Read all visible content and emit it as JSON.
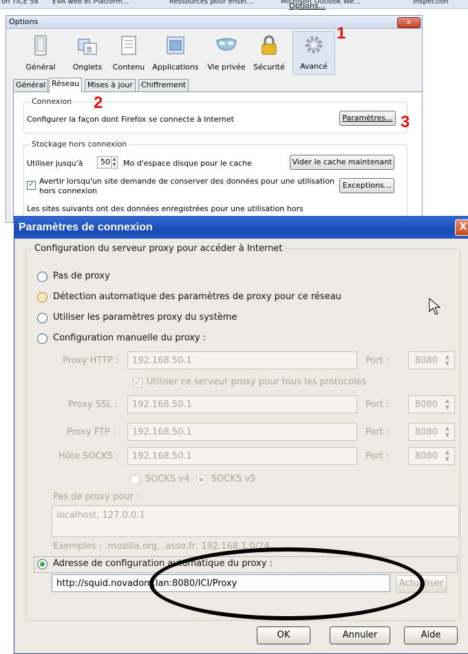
{
  "topbar": {
    "items": [
      "on TICE 58",
      "EVA web et Platform...",
      "Ressources pour ensei...",
      "Options...",
      "Microsoft Outlook We...",
      "Inspection"
    ]
  },
  "options_window": {
    "title": "Options",
    "close": "x",
    "panes": [
      {
        "label": "Général",
        "icon": "general-icon"
      },
      {
        "label": "Onglets",
        "icon": "tabs-icon"
      },
      {
        "label": "Contenu",
        "icon": "content-icon"
      },
      {
        "label": "Applications",
        "icon": "applications-icon"
      },
      {
        "label": "Vie privée",
        "icon": "privacy-mask-icon"
      },
      {
        "label": "Sécurité",
        "icon": "padlock-icon"
      },
      {
        "label": "Avancé",
        "icon": "gear-icon"
      }
    ],
    "tabs": [
      "Général",
      "Réseau",
      "Mises à jour",
      "Chiffrement"
    ],
    "connexion": {
      "label": "Connexion",
      "text": "Configurer la façon dont Firefox se connecte à Internet",
      "button": "Paramètres..."
    },
    "offline": {
      "label": "Stockage hors connexion",
      "use_up_to": "Utiliser jusqu'à",
      "cache_value": "50",
      "cache_unit": "Mo d'espace disque pour le cache",
      "clear_button": "Vider le cache maintenant",
      "warn_line1": "Avertir lorsqu'un site demande de conserver des données pour une utilisation",
      "warn_line2": "hors connexion",
      "exceptions_button": "Exceptions...",
      "sites_text": "Les sites suivants ont des données enregistrées pour une utilisation hors"
    },
    "markers": [
      "1",
      "2",
      "3"
    ]
  },
  "dialog": {
    "title": "Paramètres de connexion",
    "close": "X",
    "group_label": "Configuration du serveur proxy pour accéder à Internet",
    "options": {
      "no_proxy": "Pas de proxy",
      "auto_detect": "Détection automatique des paramètres de proxy pour ce réseau",
      "system": "Utiliser les paramètres proxy du système",
      "manual": "Configuration manuelle du proxy :"
    },
    "manual": {
      "http_label": "Proxy HTTP :",
      "http_value": "192.168.50.1",
      "http_port": "8080",
      "same_proxy": "Utiliser ce serveur proxy pour tous les protocoles",
      "ssl_label": "Proxy SSL :",
      "ssl_value": "192.168.50.1",
      "ssl_port": "8080",
      "ftp_label": "Proxy FTP :",
      "ftp_value": "192.168.50.1",
      "ftp_port": "8080",
      "socks_label": "Hôte SOCKS :",
      "socks_value": "192.168.50.1",
      "socks_port": "8080",
      "port_label": "Port :",
      "socks_v4": "SOCKS v4",
      "socks_v5": "SOCKS v5"
    },
    "no_proxy_for_label": "Pas de proxy pour :",
    "no_proxy_for_value": "localhost, 127.0.0.1",
    "examples": "Exemples : .mozilla.org, .asso.fr, 192.168.1.0/24",
    "auto_config_label": "Adresse de configuration automatique du proxy :",
    "auto_config_url": "http://squid.novadom.lan:8080/ICI/Proxy",
    "reload_button": "Actualiser",
    "ok_button": "OK",
    "cancel_button": "Annuler",
    "help_button": "Aide"
  }
}
